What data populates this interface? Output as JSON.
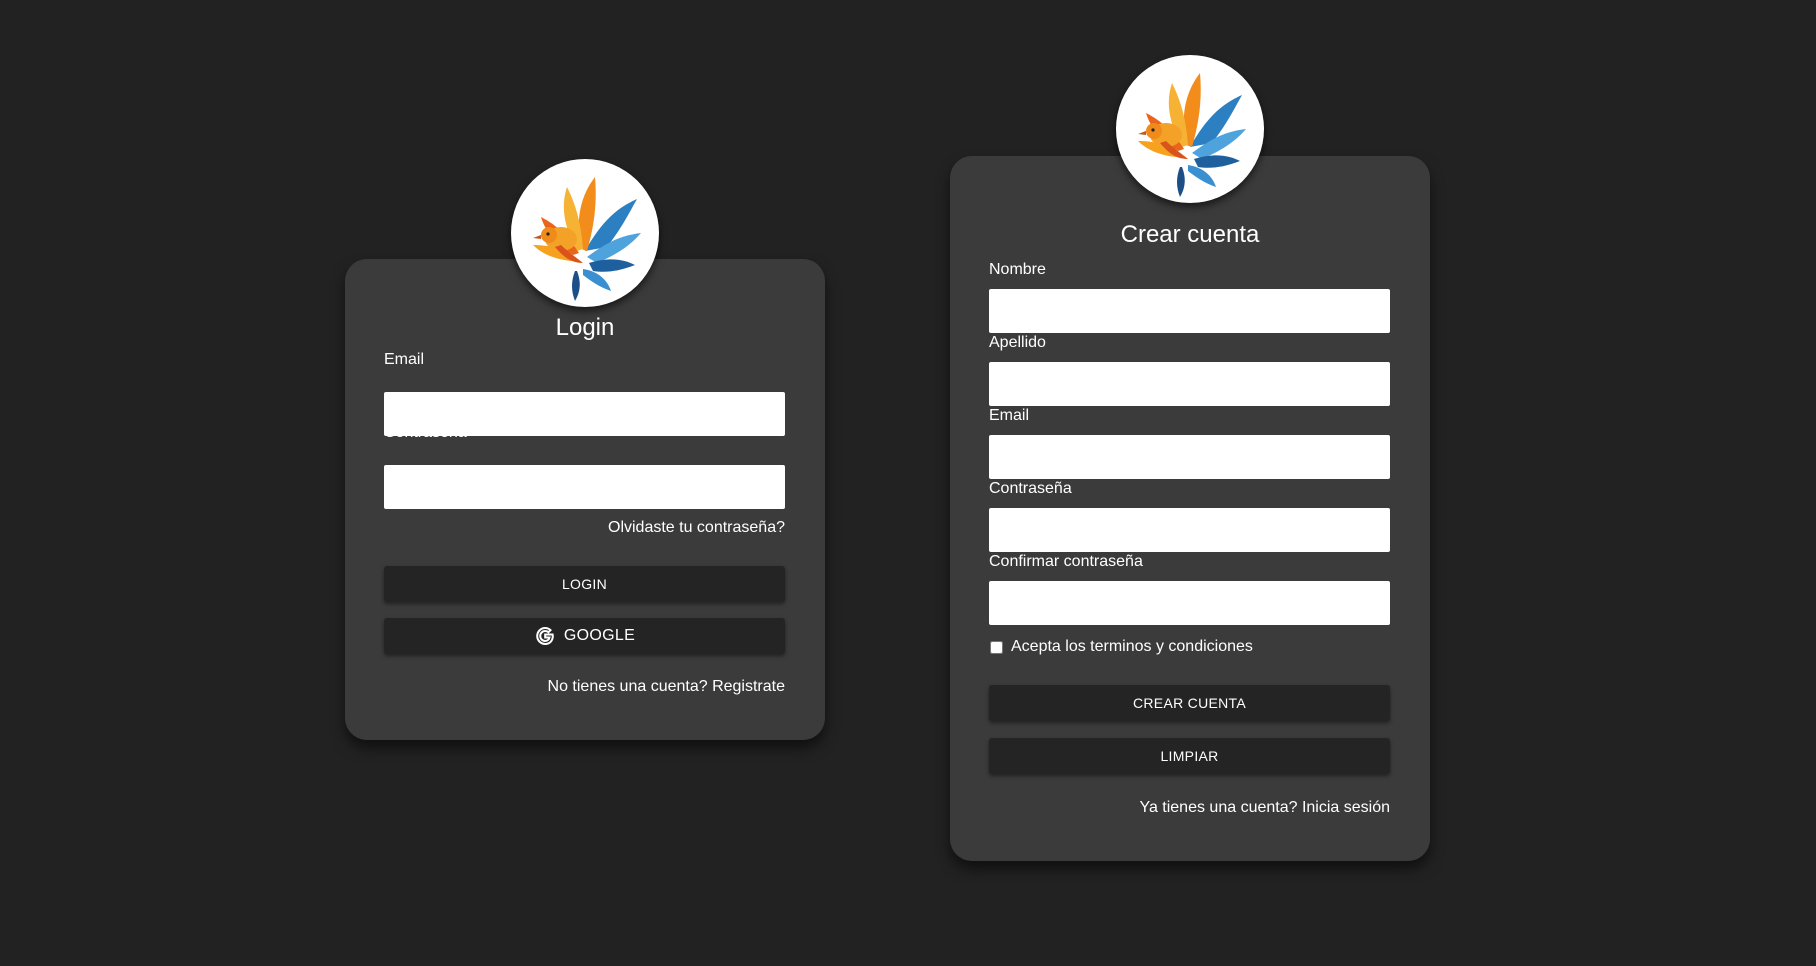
{
  "login": {
    "title": "Login",
    "email_label": "Email",
    "email_value": "",
    "password_label": "Contraseña",
    "password_value": "",
    "forgot_link": "Olvidaste tu contraseña?",
    "login_button": "LOGIN",
    "google_button": "GOOGLE",
    "register_link": "No tienes una cuenta? Registrate"
  },
  "register": {
    "title": "Crear cuenta",
    "name_label": "Nombre",
    "lastname_label": "Apellido",
    "email_label": "Email",
    "password_label": "Contraseña",
    "confirm_label": "Confirmar contraseña",
    "terms_label": "Acepta los terminos y condiciones",
    "terms_checked": false,
    "create_button": "CREAR CUENTA",
    "clear_button": "LIMPIAR",
    "login_link": "Ya tienes una cuenta? Inicia sesión"
  },
  "icons": {
    "logo": "phoenix-bird-logo",
    "google": "google-g-icon"
  },
  "colors": {
    "background": "#222222",
    "card": "#3b3b3b",
    "button": "#242424",
    "input": "#ffffff",
    "text": "#ffffff"
  }
}
